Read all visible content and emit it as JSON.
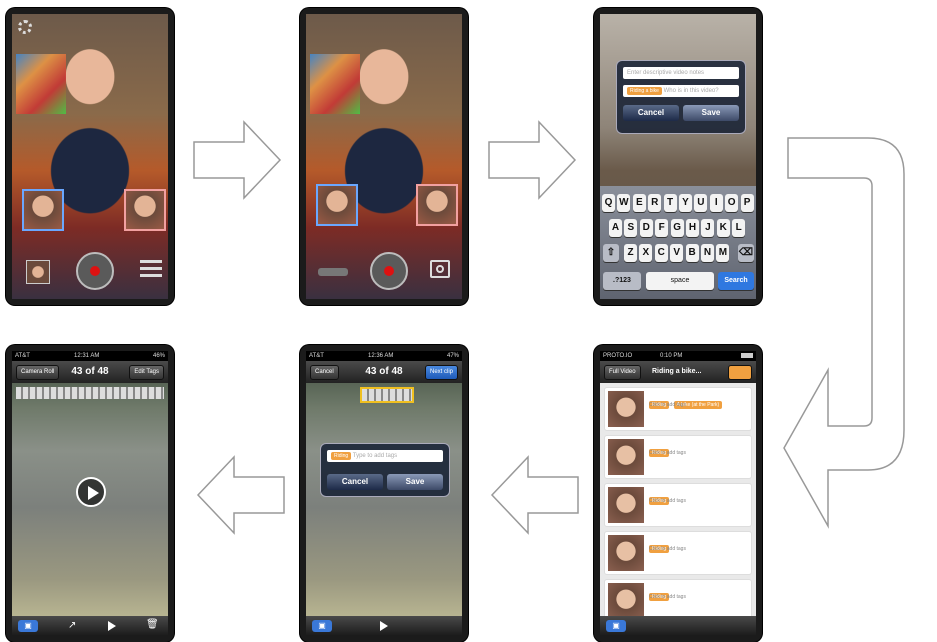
{
  "screen1": {
    "thumbs": [
      "thumb-left",
      "thumb-right"
    ]
  },
  "screen2": {},
  "screen3": {
    "desc_placeholder": "Enter descriptive video notes",
    "tag_label": "Riding a bike",
    "who_placeholder": "Who is in this video?",
    "cancel": "Cancel",
    "save": "Save",
    "keys_row1": [
      "Q",
      "W",
      "E",
      "R",
      "T",
      "Y",
      "U",
      "I",
      "O",
      "P"
    ],
    "keys_row2": [
      "A",
      "S",
      "D",
      "F",
      "G",
      "H",
      "J",
      "K",
      "L"
    ],
    "keys_row3": [
      "Z",
      "X",
      "C",
      "V",
      "B",
      "N",
      "M"
    ],
    "key_123": ".?123",
    "key_space": "space",
    "key_search": "Search"
  },
  "screen4": {
    "status_carrier": "PROTO.IO",
    "status_time": "0:10 PM",
    "back_button": "Full Video",
    "title": "Riding a bike...",
    "items": [
      {
        "tags": [
          "Riding",
          "A bike (at the Park)"
        ],
        "hint": "Click to add tags"
      },
      {
        "tags": [
          "Riding"
        ],
        "hint": "Click to add tags"
      },
      {
        "tags": [
          "Riding"
        ],
        "hint": "Click to add tags"
      },
      {
        "tags": [
          "Riding"
        ],
        "hint": "Click to add tags"
      },
      {
        "tags": [
          "Riding"
        ],
        "hint": "Click to add tags"
      }
    ]
  },
  "screen5": {
    "status_carrier": "AT&T",
    "status_time": "12:36 AM",
    "status_battery": "47%",
    "cancel_top": "Cancel",
    "counter": "43 of 48",
    "next_clip": "Next clip",
    "tag_label": "Riding",
    "tag_placeholder": "Type to add tags",
    "cancel": "Cancel",
    "save": "Save"
  },
  "screen6": {
    "status_carrier": "AT&T",
    "status_time": "12:31 AM",
    "status_battery": "46%",
    "back_button": "Camera Roll",
    "counter": "43 of 48",
    "edit_tags": "Edit Tags"
  }
}
